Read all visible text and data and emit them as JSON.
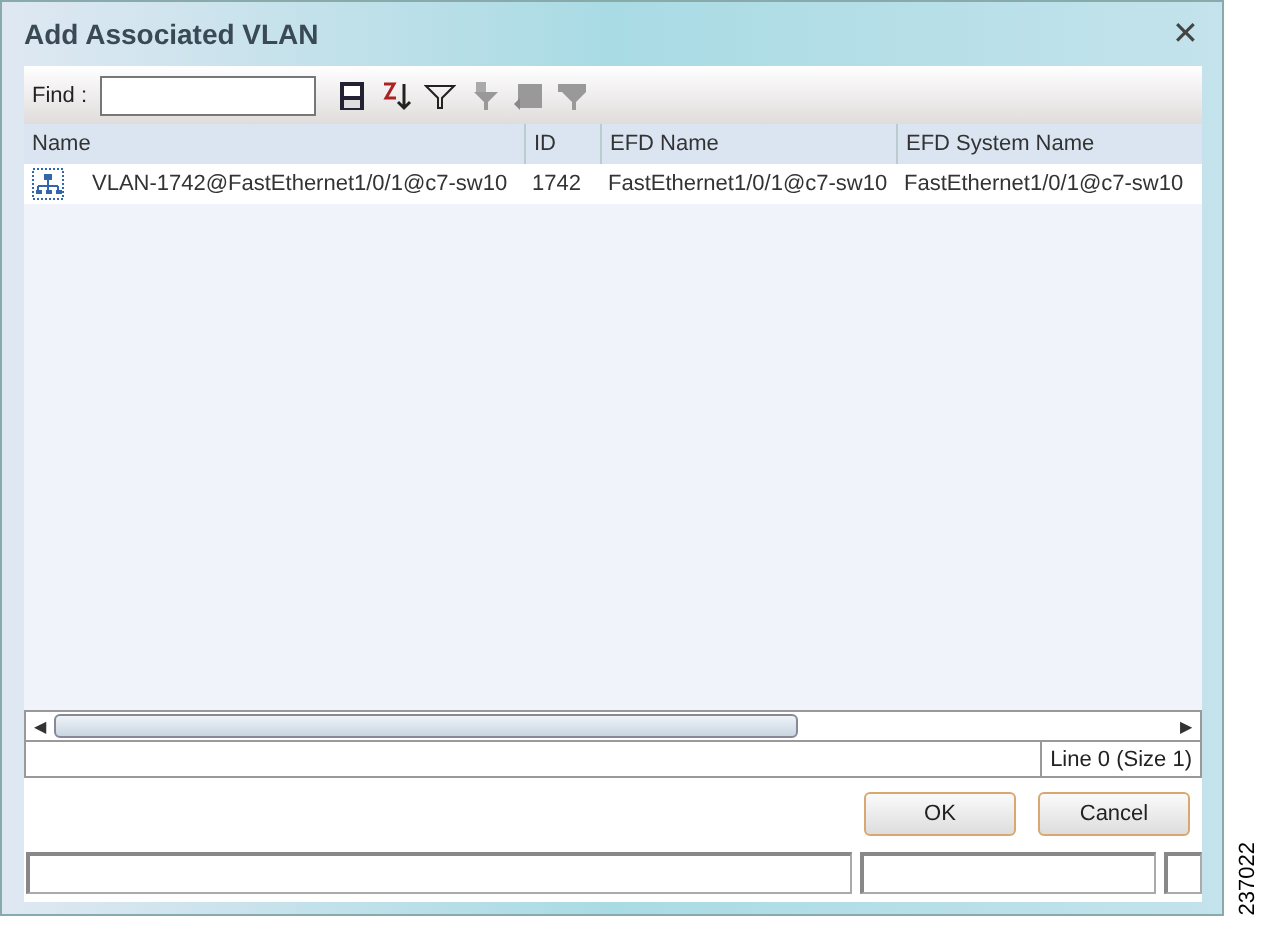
{
  "window": {
    "title": "Add Associated VLAN",
    "close": "✕"
  },
  "toolbar": {
    "find_label": "Find :"
  },
  "table": {
    "columns": [
      "Name",
      "ID",
      "EFD Name",
      "EFD System Name"
    ],
    "rows": [
      {
        "cells": [
          "VLAN-1742@FastEthernet1/0/1@c7-sw10",
          "1742",
          "FastEthernet1/0/1@c7-sw10",
          "FastEthernet1/0/1@c7-sw10"
        ],
        "selected": false
      }
    ]
  },
  "scroll_arrows": [
    "◀",
    "▶"
  ],
  "status": "Line 0 (Size 1)",
  "buttons": [
    "OK",
    "Cancel"
  ],
  "figure_id": "237022"
}
